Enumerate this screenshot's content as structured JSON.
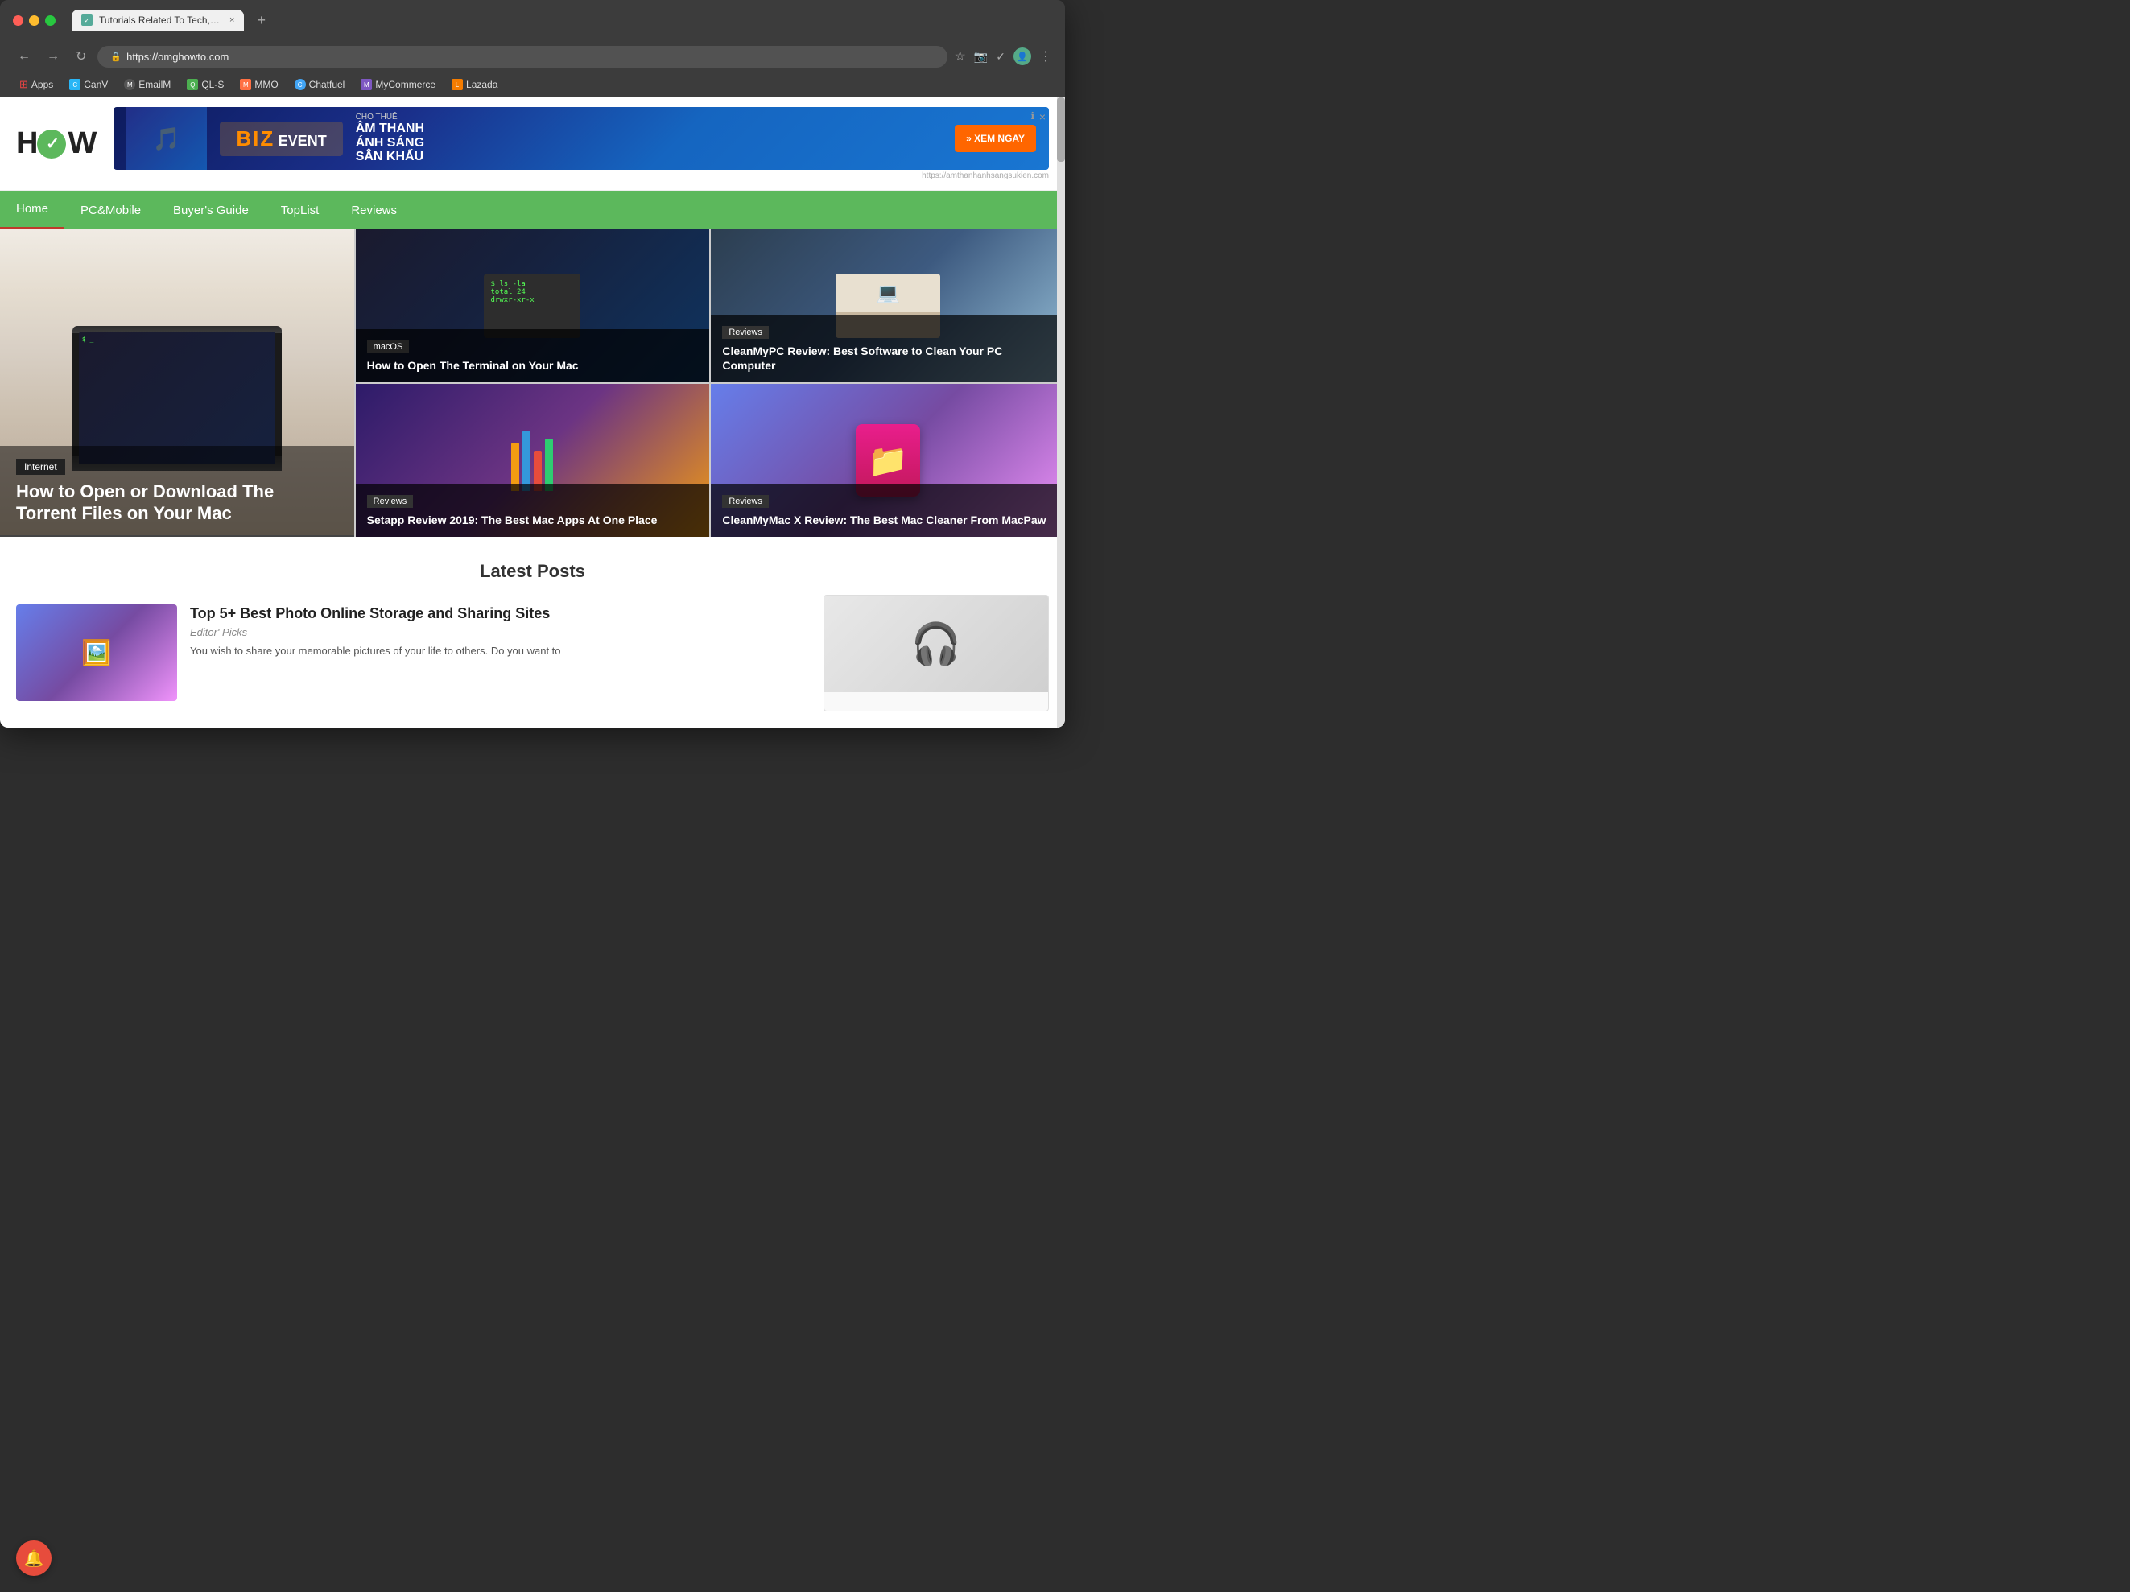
{
  "browser": {
    "url": "https://omghowto.com",
    "tab_title": "Tutorials Related To Tech, Win...",
    "back_btn": "←",
    "forward_btn": "→",
    "refresh_btn": "↻",
    "new_tab_btn": "+",
    "more_btn": "⋮",
    "bookmarks": [
      {
        "label": "Apps",
        "color": "#e44",
        "icon": "⊞"
      },
      {
        "label": "CanV",
        "color": "#29b6f6",
        "icon": "C"
      },
      {
        "label": "EmailM",
        "color": "#555",
        "icon": "M"
      },
      {
        "label": "QL-S",
        "color": "#4caf50",
        "icon": "Q"
      },
      {
        "label": "MMO",
        "color": "#ff7043",
        "icon": "M"
      },
      {
        "label": "Chatfuel",
        "color": "#42a5f5",
        "icon": "C"
      },
      {
        "label": "MyCommerce",
        "color": "#7e57c2",
        "icon": "M"
      },
      {
        "label": "Lazada",
        "color": "#f57c00",
        "icon": "L"
      }
    ]
  },
  "site": {
    "logo_h": "H",
    "logo_w": "W",
    "logo_o": "O"
  },
  "ad": {
    "title": "CHO THUÊ",
    "line1": "ÂM THANH",
    "line2": "ÁNH SÁNG",
    "line3": "SÂN KHẤU",
    "cta": "» XEM NGAY",
    "url_text": "https://amthanhanhsangsukien.com"
  },
  "nav": {
    "items": [
      "Home",
      "PC&Mobile",
      "Buyer's Guide",
      "TopList",
      "Reviews"
    ],
    "active": "Home"
  },
  "featured": {
    "main": {
      "category": "Internet",
      "title": "How to Open or Download The Torrent Files on Your Mac"
    },
    "top_right_1": {
      "category": "macOS",
      "title": "How to Open The Terminal on Your Mac"
    },
    "top_right_2": {
      "category": "Reviews",
      "title": "CleanMyPC Review: Best Software to Clean Your PC Computer"
    },
    "bottom_right_1": {
      "category": "Reviews",
      "title": "Setapp Review 2019: The Best Mac Apps At One Place"
    },
    "bottom_right_2": {
      "category": "Reviews",
      "title": "CleanMyMac X Review: The Best Mac Cleaner From MacPaw"
    }
  },
  "latest_posts": {
    "section_title": "Latest Posts",
    "posts": [
      {
        "title": "Top 5+ Best Photo Online Storage and Sharing Sites",
        "category": "Editor' Picks",
        "excerpt": "You wish to share your memorable pictures of your life to others. Do you want to"
      }
    ]
  },
  "icons": {
    "bell": "🔔",
    "star": "☆",
    "lock": "🔒",
    "camera": "📷",
    "check": "✓",
    "user": "👤",
    "apps": "⊞"
  }
}
